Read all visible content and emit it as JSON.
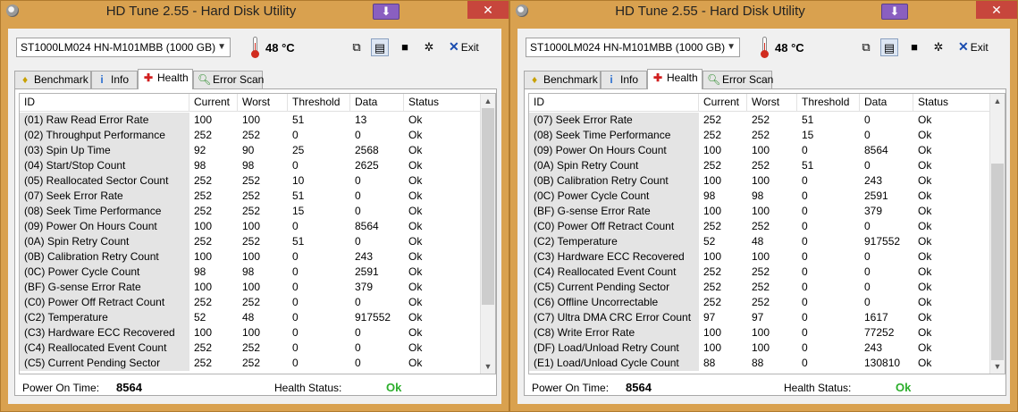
{
  "app_title": "HD Tune 2.55 - Hard Disk Utility",
  "close_glyph": "✕",
  "minimize_glyph": "⬇",
  "drive": "ST1000LM024 HN-M101MBB (1000 GB)",
  "temperature": "48 °C",
  "exit_label": "Exit",
  "tabs": [
    {
      "label": "Benchmark",
      "icon": "bulb-icon"
    },
    {
      "label": "Info",
      "icon": "info-icon"
    },
    {
      "label": "Health",
      "icon": "health-cross-icon"
    },
    {
      "label": "Error Scan",
      "icon": "search-icon"
    }
  ],
  "columns": [
    "ID",
    "Current",
    "Worst",
    "Threshold",
    "Data",
    "Status"
  ],
  "footer": {
    "power_on_label": "Power On Time:",
    "power_on_value": "8564",
    "health_label": "Health Status:",
    "health_value": "Ok"
  },
  "colors": {
    "window_frame": "#d9a14f",
    "close_button": "#c7463c",
    "ok_green": "#2cae2c"
  },
  "windows": [
    {
      "rows": [
        [
          "(01) Raw Read Error Rate",
          "100",
          "100",
          "51",
          "13",
          "Ok"
        ],
        [
          "(02) Throughput Performance",
          "252",
          "252",
          "0",
          "0",
          "Ok"
        ],
        [
          "(03) Spin Up Time",
          "92",
          "90",
          "25",
          "2568",
          "Ok"
        ],
        [
          "(04) Start/Stop Count",
          "98",
          "98",
          "0",
          "2625",
          "Ok"
        ],
        [
          "(05) Reallocated Sector Count",
          "252",
          "252",
          "10",
          "0",
          "Ok"
        ],
        [
          "(07) Seek Error Rate",
          "252",
          "252",
          "51",
          "0",
          "Ok"
        ],
        [
          "(08) Seek Time Performance",
          "252",
          "252",
          "15",
          "0",
          "Ok"
        ],
        [
          "(09) Power On Hours Count",
          "100",
          "100",
          "0",
          "8564",
          "Ok"
        ],
        [
          "(0A) Spin Retry Count",
          "252",
          "252",
          "51",
          "0",
          "Ok"
        ],
        [
          "(0B) Calibration Retry Count",
          "100",
          "100",
          "0",
          "243",
          "Ok"
        ],
        [
          "(0C) Power Cycle Count",
          "98",
          "98",
          "0",
          "2591",
          "Ok"
        ],
        [
          "(BF) G-sense Error Rate",
          "100",
          "100",
          "0",
          "379",
          "Ok"
        ],
        [
          "(C0) Power Off Retract Count",
          "252",
          "252",
          "0",
          "0",
          "Ok"
        ],
        [
          "(C2) Temperature",
          "52",
          "48",
          "0",
          "917552",
          "Ok"
        ],
        [
          "(C3) Hardware ECC Recovered",
          "100",
          "100",
          "0",
          "0",
          "Ok"
        ],
        [
          "(C4) Reallocated Event Count",
          "252",
          "252",
          "0",
          "0",
          "Ok"
        ],
        [
          "(C5) Current Pending Sector",
          "252",
          "252",
          "0",
          "0",
          "Ok"
        ]
      ]
    },
    {
      "rows": [
        [
          "(07) Seek Error Rate",
          "252",
          "252",
          "51",
          "0",
          "Ok"
        ],
        [
          "(08) Seek Time Performance",
          "252",
          "252",
          "15",
          "0",
          "Ok"
        ],
        [
          "(09) Power On Hours Count",
          "100",
          "100",
          "0",
          "8564",
          "Ok"
        ],
        [
          "(0A) Spin Retry Count",
          "252",
          "252",
          "51",
          "0",
          "Ok"
        ],
        [
          "(0B) Calibration Retry Count",
          "100",
          "100",
          "0",
          "243",
          "Ok"
        ],
        [
          "(0C) Power Cycle Count",
          "98",
          "98",
          "0",
          "2591",
          "Ok"
        ],
        [
          "(BF) G-sense Error Rate",
          "100",
          "100",
          "0",
          "379",
          "Ok"
        ],
        [
          "(C0) Power Off Retract Count",
          "252",
          "252",
          "0",
          "0",
          "Ok"
        ],
        [
          "(C2) Temperature",
          "52",
          "48",
          "0",
          "917552",
          "Ok"
        ],
        [
          "(C3) Hardware ECC Recovered",
          "100",
          "100",
          "0",
          "0",
          "Ok"
        ],
        [
          "(C4) Reallocated Event Count",
          "252",
          "252",
          "0",
          "0",
          "Ok"
        ],
        [
          "(C5) Current Pending Sector",
          "252",
          "252",
          "0",
          "0",
          "Ok"
        ],
        [
          "(C6) Offline Uncorrectable",
          "252",
          "252",
          "0",
          "0",
          "Ok"
        ],
        [
          "(C7) Ultra DMA CRC Error Count",
          "97",
          "97",
          "0",
          "1617",
          "Ok"
        ],
        [
          "(C8) Write Error Rate",
          "100",
          "100",
          "0",
          "77252",
          "Ok"
        ],
        [
          "(DF) Load/Unload Retry Count",
          "100",
          "100",
          "0",
          "243",
          "Ok"
        ],
        [
          "(E1) Load/Unload Cycle Count",
          "88",
          "88",
          "0",
          "130810",
          "Ok"
        ]
      ]
    }
  ]
}
